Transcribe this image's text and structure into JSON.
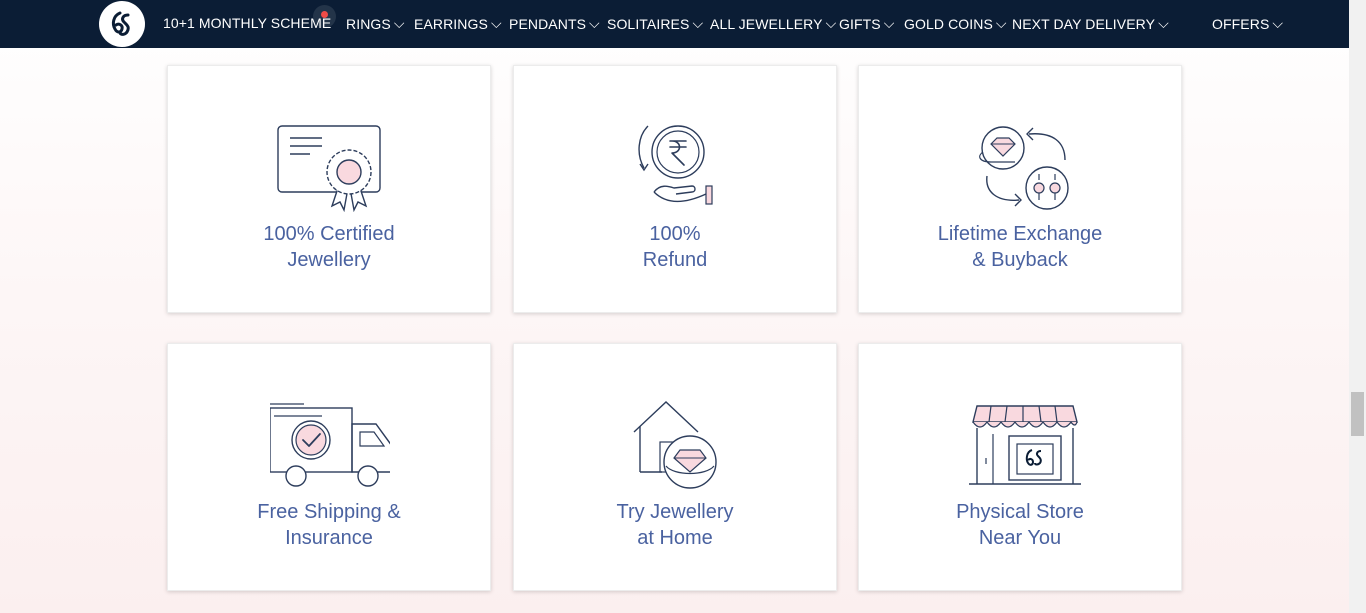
{
  "navbar": {
    "logo_text": "KS",
    "items": [
      {
        "label": "10+1 MONTHLY SCHEME",
        "has_chevron": false
      },
      {
        "label": "RINGS",
        "has_chevron": true
      },
      {
        "label": "EARRINGS",
        "has_chevron": true
      },
      {
        "label": "PENDANTS",
        "has_chevron": true
      },
      {
        "label": "SOLITAIRES",
        "has_chevron": true
      },
      {
        "label": "ALL JEWELLERY",
        "has_chevron": true
      },
      {
        "label": "GIFTS",
        "has_chevron": true
      },
      {
        "label": "GOLD COINS",
        "has_chevron": true
      },
      {
        "label": "NEXT DAY DELIVERY",
        "has_chevron": true
      },
      {
        "label": "OFFERS",
        "has_chevron": true
      }
    ],
    "chevron": "⌵"
  },
  "features": [
    {
      "icon": "certificate-icon",
      "line1": "100% Certified",
      "line2": "Jewellery"
    },
    {
      "icon": "refund-icon",
      "line1": "100%",
      "line2": "Refund"
    },
    {
      "icon": "exchange-icon",
      "line1": "Lifetime Exchange",
      "line2": "& Buyback"
    },
    {
      "icon": "delivery-truck-icon",
      "line1": "Free Shipping &",
      "line2": "Insurance"
    },
    {
      "icon": "home-try-icon",
      "line1": "Try Jewellery",
      "line2": "at Home"
    },
    {
      "icon": "store-icon",
      "line1": "Physical Store",
      "line2": "Near You"
    }
  ],
  "colors": {
    "navbar_bg": "#0b1d35",
    "label_text": "#4a62a0",
    "icon_stroke": "#2d3d5c",
    "icon_fill_pink": "#f9d9df",
    "notification_dot": "#ef4b47"
  }
}
